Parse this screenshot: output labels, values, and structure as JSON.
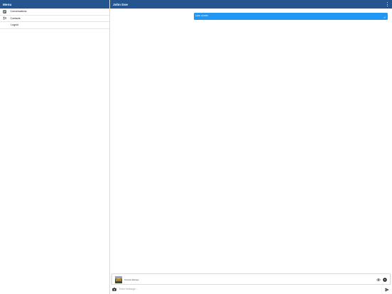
{
  "sidebar": {
    "title": "Menu",
    "items": [
      {
        "label": "Conversations",
        "icon": "chat-list-icon"
      },
      {
        "label": "Contacts",
        "icon": "contacts-icon"
      },
      {
        "label": "Logout",
        "icon": ""
      }
    ]
  },
  "header": {
    "title": "John Doe",
    "menu_icon": "kebab-menu-icon"
  },
  "messages": [
    {
      "text": "Hallo 123456",
      "status_icon": "double-check-icon"
    }
  ],
  "attachment": {
    "filename": "Cheviot Ranser",
    "view_icon": "eye-icon",
    "remove_icon": "close-circle-icon"
  },
  "composer": {
    "placeholder": "Enter message...",
    "value": "",
    "camera_icon": "camera-icon",
    "send_icon": "send-icon"
  },
  "colors": {
    "header": "#24558f",
    "bubble": "#2196f3"
  }
}
